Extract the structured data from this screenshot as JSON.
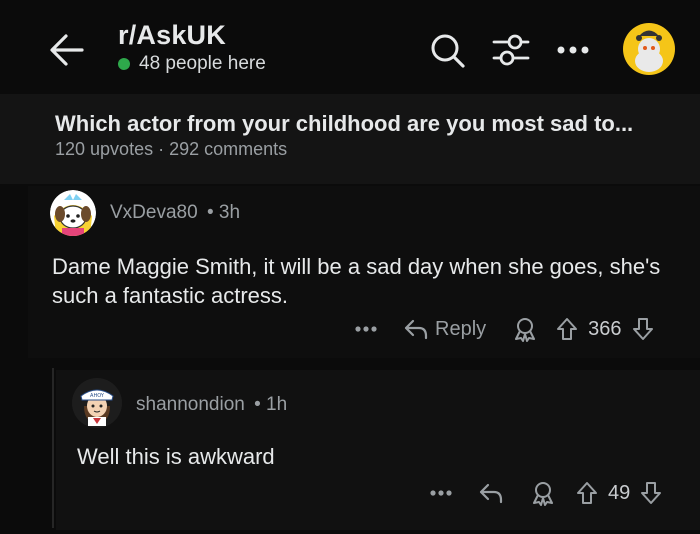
{
  "header": {
    "subreddit": "r/AskUK",
    "online_text": "48 people here"
  },
  "post": {
    "title": "Which actor from your childhood are you most sad to...",
    "meta": "120 upvotes · 292 comments"
  },
  "comments": [
    {
      "username": "VxDeva80",
      "time": "• 3h",
      "body": "Dame Maggie Smith, it will be a sad day when she goes, she's such a fantastic actress.",
      "reply_label": "Reply",
      "votes": "366"
    },
    {
      "username": "shannondion",
      "time": "• 1h",
      "body": "Well this is awkward",
      "votes": "49"
    }
  ],
  "colors": {
    "background": "#0b0b0b",
    "post_bar": "#141414",
    "online_dot": "#2ea84b",
    "avatar_yellow": "#f5c518",
    "muted_text": "#9a9fa3"
  },
  "icons": [
    "back-arrow-icon",
    "search-icon",
    "filter-icon",
    "more-icon",
    "reply-icon",
    "award-icon",
    "upvote-icon",
    "downvote-icon"
  ]
}
